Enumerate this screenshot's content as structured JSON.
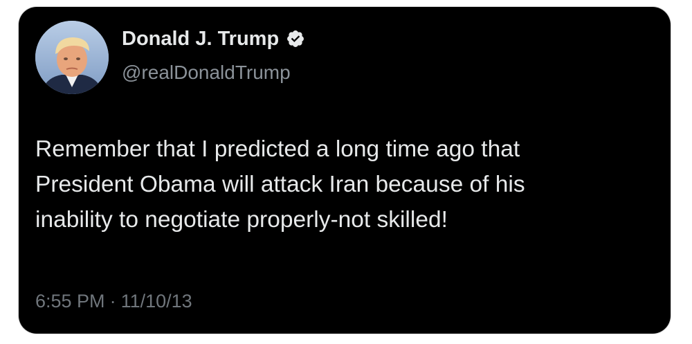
{
  "author": {
    "display_name": "Donald J. Trump",
    "handle": "@realDonaldTrump",
    "verified": true,
    "avatar_icon": "profile-photo",
    "verified_icon": "verified-badge-icon"
  },
  "tweet": {
    "lines": [
      "Remember that I predicted a long time ago that",
      "President Obama will attack Iran because of his",
      "inability to negotiate properly-not skilled!"
    ]
  },
  "meta": {
    "time": "6:55 PM",
    "separator": "·",
    "date": "11/10/13"
  },
  "colors": {
    "background": "#000000",
    "text": "#e7e9ea",
    "secondary_text": "#8b9299",
    "verified_badge": "#1d9bf0"
  }
}
